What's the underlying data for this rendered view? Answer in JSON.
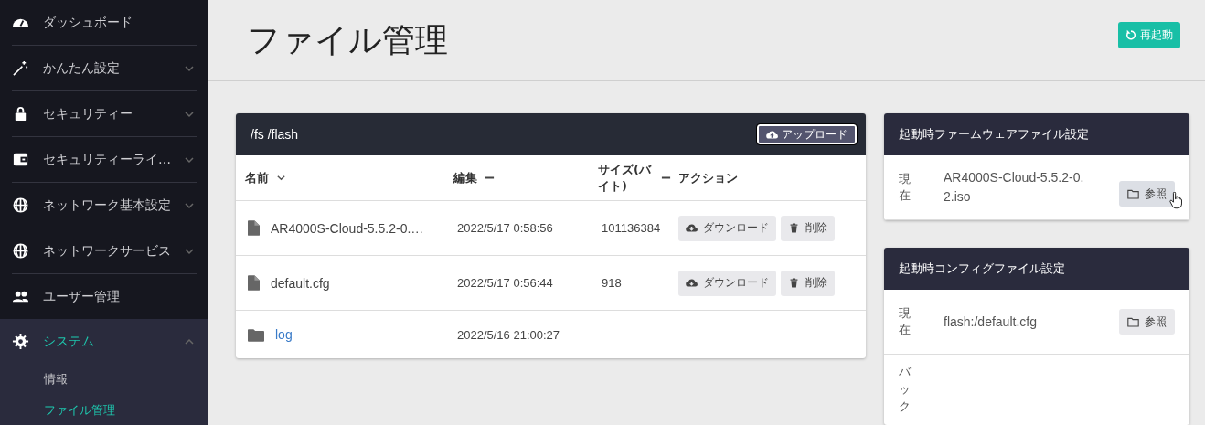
{
  "sidebar": {
    "items": [
      {
        "label": "ダッシュボード",
        "has_submenu": false,
        "expanded": false,
        "selected": false
      },
      {
        "label": "かんたん設定",
        "has_submenu": true,
        "expanded": false,
        "selected": false
      },
      {
        "label": "セキュリティー",
        "has_submenu": true,
        "expanded": false,
        "selected": false
      },
      {
        "label": "セキュリティーライ…",
        "has_submenu": true,
        "expanded": false,
        "selected": false
      },
      {
        "label": "ネットワーク基本設定",
        "has_submenu": true,
        "expanded": false,
        "selected": false
      },
      {
        "label": "ネットワークサービス",
        "has_submenu": true,
        "expanded": false,
        "selected": false
      },
      {
        "label": "ユーザー管理",
        "has_submenu": false,
        "expanded": false,
        "selected": false
      },
      {
        "label": "システム",
        "has_submenu": true,
        "expanded": true,
        "selected": true,
        "children": [
          {
            "label": "情報",
            "selected": false
          },
          {
            "label": "ファイル管理",
            "selected": true
          }
        ]
      }
    ]
  },
  "page": {
    "title": "ファイル管理",
    "restart_button": "再起動"
  },
  "file_panel": {
    "path": "/fs /flash",
    "upload_button": "アップロード",
    "columns": [
      {
        "label": "名前",
        "sortable": true,
        "sorted": true
      },
      {
        "label": "編集",
        "sortable": true,
        "sorted": false
      },
      {
        "label": "サイズ(バイト)",
        "sortable": true,
        "sorted": false
      },
      {
        "label": "アクション",
        "sortable": false
      }
    ],
    "rows": [
      {
        "kind": "file",
        "name": "AR4000S-Cloud-5.5.2-0.…",
        "modified": "2022/5/17 0:58:56",
        "size": "101136384",
        "actions": [
          "ダウンロード",
          "削除"
        ]
      },
      {
        "kind": "file",
        "name": "default.cfg",
        "modified": "2022/5/17 0:56:44",
        "size": "918",
        "actions": [
          "ダウンロード",
          "削除"
        ]
      },
      {
        "kind": "folder",
        "name": "log",
        "modified": "2022/5/16 21:00:27"
      }
    ]
  },
  "settings_cards": [
    {
      "title": "起動時ファームウェアファイル設定",
      "rows": [
        {
          "label": "現在",
          "value": "AR4000S-Cloud-5.5.2-0.2.iso",
          "button": "参照",
          "hovered": true
        }
      ]
    },
    {
      "title": "起動時コンフィグファイル設定",
      "rows": [
        {
          "label": "現在",
          "value": "flash:/default.cfg",
          "button": "参照",
          "hovered": false
        },
        {
          "label": "バック"
        }
      ]
    }
  ]
}
